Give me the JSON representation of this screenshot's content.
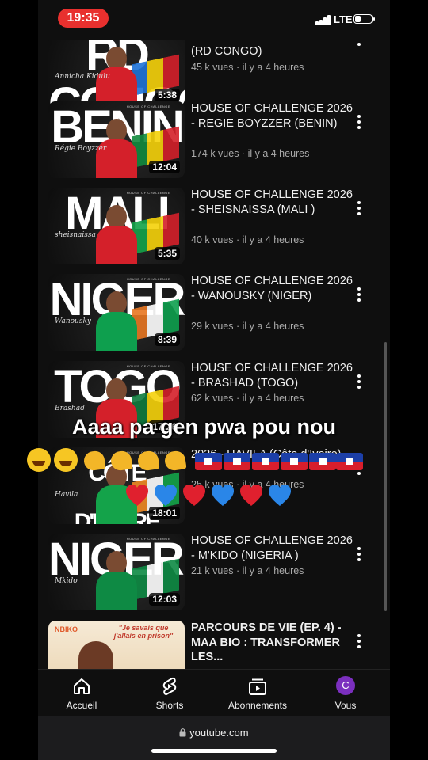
{
  "status_bar": {
    "time": "19:35",
    "network": "LTE",
    "battery_level": 0.35,
    "accent": "#e8302e"
  },
  "videos": [
    {
      "title": "(RD CONGO)",
      "meta": "45 k vues · il y a 4 heures",
      "duration": "5:38",
      "thumb_word": "RD CONGO",
      "signature": "Annicha Kidulu",
      "colors": [
        "#1e73d9",
        "#f5d20a",
        "#d4202a"
      ]
    },
    {
      "title": "HOUSE OF CHALLENGE 2026 - REGIE BOYZZER (BENIN)",
      "meta": "174 k vues · il y a 4 heures",
      "duration": "12:04",
      "thumb_word": "BENIN",
      "signature": "Régie Boyzzer",
      "colors": [
        "#118a3e",
        "#f5d20a",
        "#d4202a"
      ]
    },
    {
      "title": "HOUSE OF CHALLENGE 2026 - SHEISNAISSA (MALI )",
      "meta": "40 k vues · il y a 4 heures",
      "duration": "5:35",
      "thumb_word": "MALI",
      "signature": "sheisnaissa",
      "colors": [
        "#14a34a",
        "#f5d20a",
        "#d4202a"
      ]
    },
    {
      "title": "HOUSE OF CHALLENGE 2026 - WANOUSKY (NIGER)",
      "meta": "29 k vues · il y a 4 heures",
      "duration": "8:39",
      "thumb_word": "NIGER",
      "signature": "Wanousky",
      "colors": [
        "#e87722",
        "#ffffff",
        "#0e9f4e"
      ]
    },
    {
      "title": "HOUSE OF CHALLENGE 2026 - BRASHAD (TOGO)",
      "meta": "62 k vues · il y a 4 heures",
      "duration": "17:26",
      "thumb_word": "TOGO",
      "signature": "Brashad",
      "colors": [
        "#0e7a3d",
        "#f5d20a",
        "#d4202a"
      ]
    },
    {
      "title": "2026 - HAVILA (Côte d'Ivoire)",
      "meta": "25 k vues · il y a 4 heures",
      "duration": "18:01",
      "thumb_word": "CÔTE D'IVOIRE",
      "signature": "Havila",
      "colors": [
        "#f08a24",
        "#ffffff",
        "#14a34a"
      ]
    },
    {
      "title": "HOUSE OF CHALLENGE 2026 - M'KIDO (NIGERIA )",
      "meta": "21 k vues · il y a 4 heures",
      "duration": "12:03",
      "thumb_word": "NIGERIA",
      "signature": "Mkido",
      "colors": [
        "#0e8a44",
        "#ffffff",
        "#0e8a44"
      ]
    },
    {
      "title": "PARCOURS DE VIE (EP. 4) - MAA BIO : TRANSFORMER LES...",
      "meta": "",
      "duration": "",
      "thumb_word": "",
      "signature": "",
      "colors": [
        "#f3e3c8",
        "#c9a06b",
        "#e05a2b"
      ],
      "thumb_badge": "NBIKO",
      "thumb_quote": "\"Je savais que j'allais en prison\""
    }
  ],
  "thumb_header": "HOUSE OF CHALLENGE",
  "overlay": {
    "caption": "Aaaa pa gen pwa pou nou",
    "emoji_top": [
      "laugh",
      "laugh",
      "arm",
      "arm",
      "arm",
      "arm",
      "haiti-flag",
      "haiti-flag",
      "haiti-flag",
      "haiti-flag",
      "haiti-flag",
      "haiti-flag"
    ],
    "hearts": [
      "#e0202e",
      "#2a86e8",
      "#e0202e",
      "#2a86e8",
      "#e0202e",
      "#2a86e8"
    ]
  },
  "nav": {
    "home": "Accueil",
    "shorts": "Shorts",
    "subscriptions": "Abonnements",
    "you": "Vous",
    "avatar_letter": "C",
    "avatar_color": "#7b2fbf"
  },
  "browser": {
    "url": "youtube.com"
  }
}
